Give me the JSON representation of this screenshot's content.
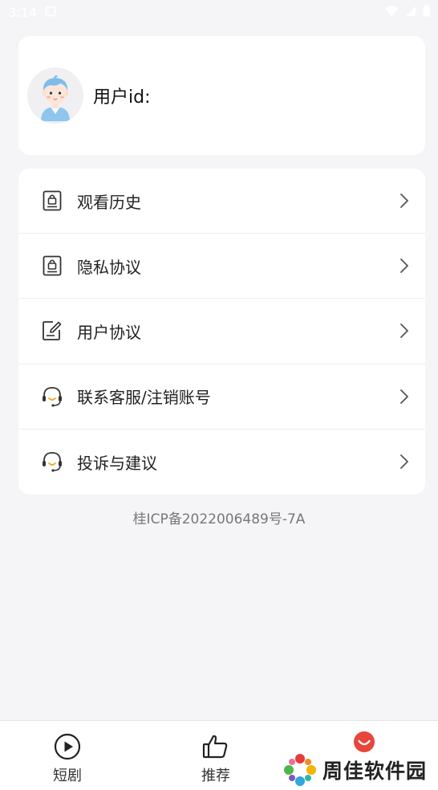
{
  "status_bar": {
    "time": "3:14"
  },
  "profile": {
    "user_id_label": "用户id:",
    "avatar_icon": "avatar-boy-icon"
  },
  "menu": {
    "items": [
      {
        "label": "观看历史",
        "icon": "lock-document-icon"
      },
      {
        "label": "隐私协议",
        "icon": "lock-document-icon"
      },
      {
        "label": "用户协议",
        "icon": "edit-document-icon"
      },
      {
        "label": "联系客服/注销账号",
        "icon": "headset-icon"
      },
      {
        "label": "投诉与建议",
        "icon": "headset-icon"
      }
    ]
  },
  "footer": {
    "icp": "桂ICP备2022006489号-7A"
  },
  "bottom_nav": {
    "items": [
      {
        "label": "短剧",
        "icon": "play-circle-icon"
      },
      {
        "label": "推荐",
        "icon": "thumbs-up-icon"
      },
      {
        "label": "",
        "icon": "smiley-mine-icon",
        "active": true
      }
    ]
  },
  "watermark": {
    "text": "周佳软件园"
  },
  "colors": {
    "accent": "#e8453c",
    "background": "#f5f5f7",
    "card": "#ffffff"
  }
}
